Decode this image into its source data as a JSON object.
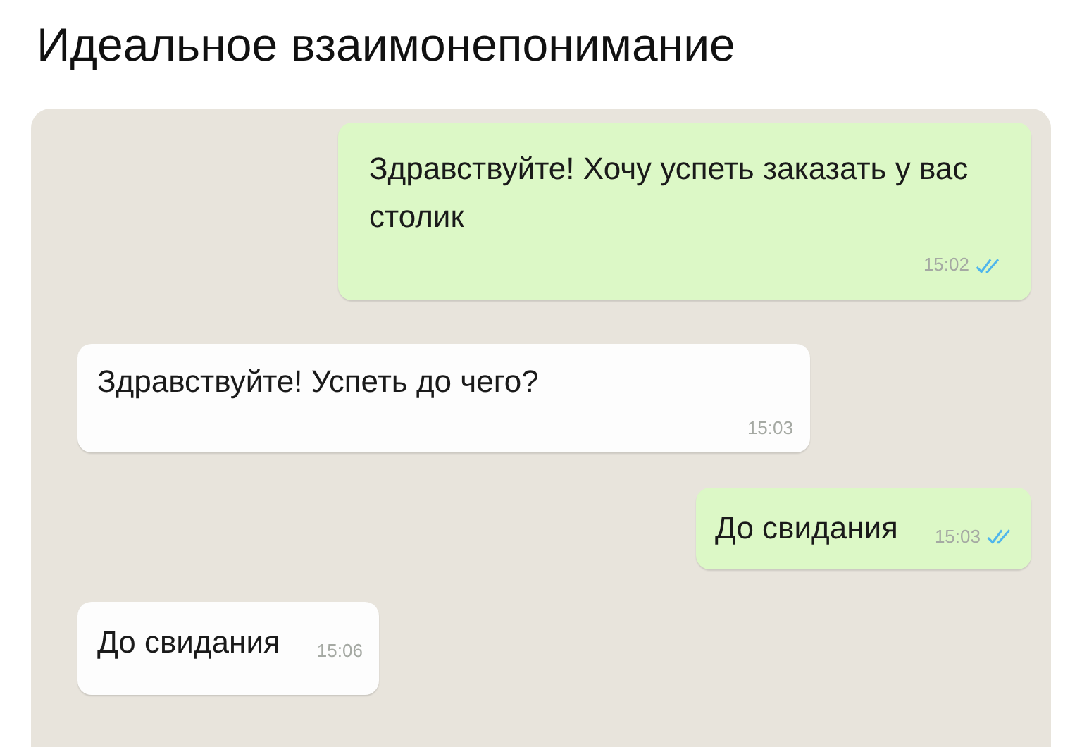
{
  "caption": "Идеальное взаимонепонимание",
  "messages": [
    {
      "kind": "outgoing",
      "text": "Здравствуйте! Хочу успеть заказать у вас столик",
      "time": "15:02",
      "read": true
    },
    {
      "kind": "incoming",
      "text": "Здравствуйте! Успеть до чего?",
      "time": "15:03"
    },
    {
      "kind": "outgoing",
      "text": "До свидания",
      "time": "15:03",
      "read": true
    },
    {
      "kind": "incoming",
      "text": "До свидания",
      "time": "15:06"
    }
  ]
}
